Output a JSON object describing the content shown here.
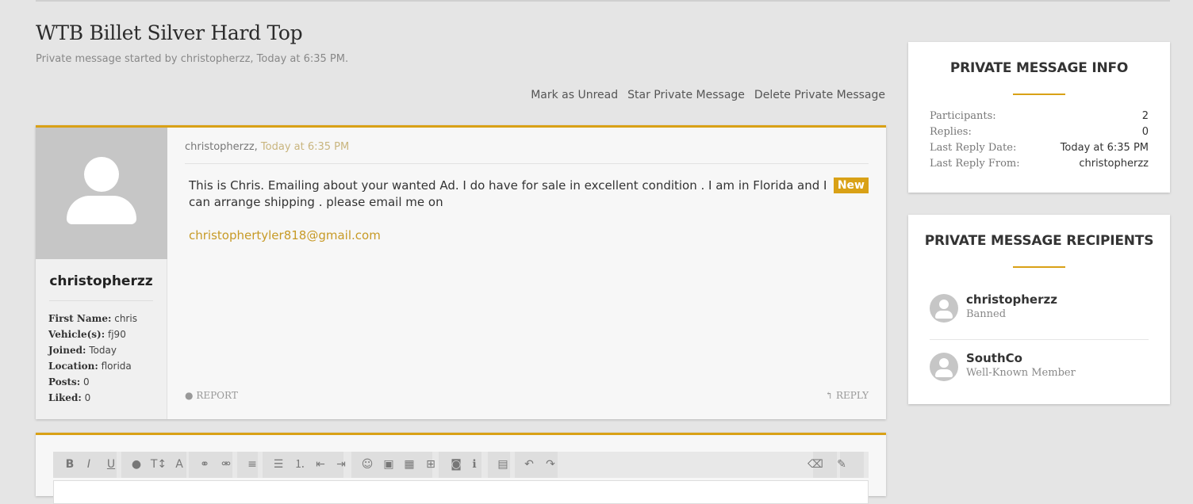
{
  "page": {
    "title": "WTB Billet Silver Hard Top",
    "subtitle": "Private message started by christopherzz, Today at 6:35 PM."
  },
  "actions": {
    "mark_unread": "Mark as Unread",
    "star": "Star Private Message",
    "delete": "Delete Private Message"
  },
  "message": {
    "author": "christopherzz",
    "meta_author": "christopherzz,",
    "meta_time": "Today at 6:35 PM",
    "badge": "New",
    "body": "This is Chris. Emailing about your wanted Ad. I do have for sale in excellent condition . I am in Florida and I can arrange shipping . please email me on",
    "email": "christophertyler818@gmail.com",
    "report": "REPORT",
    "reply": "REPLY",
    "user_info": [
      {
        "key": "First Name:",
        "value": "chris"
      },
      {
        "key": "Vehicle(s):",
        "value": "fj90"
      },
      {
        "key": "Joined:",
        "value": "Today"
      },
      {
        "key": "Location:",
        "value": "florida"
      },
      {
        "key": "Posts:",
        "value": "0"
      },
      {
        "key": "Liked:",
        "value": "0"
      }
    ]
  },
  "info_card": {
    "heading": "PRIVATE MESSAGE INFO",
    "rows": [
      {
        "key": "Participants:",
        "value": "2"
      },
      {
        "key": "Replies:",
        "value": "0"
      },
      {
        "key": "Last Reply Date:",
        "value": "Today at 6:35 PM"
      },
      {
        "key": "Last Reply From:",
        "value": "christopherzz"
      }
    ]
  },
  "recipients_card": {
    "heading": "PRIVATE MESSAGE RECIPIENTS",
    "recipients": [
      {
        "name": "christopherzz",
        "role": "Banned"
      },
      {
        "name": "SouthCo",
        "role": "Well-Known Member"
      }
    ]
  },
  "editor": {
    "toolbar": [
      {
        "icon": "bold-icon",
        "glyph": "B"
      },
      {
        "icon": "italic-icon",
        "glyph": "I"
      },
      {
        "icon": "underline-icon",
        "glyph": "U"
      },
      {
        "icon": "color-icon",
        "glyph": "●"
      },
      {
        "icon": "font-size-icon",
        "glyph": "T↕"
      },
      {
        "icon": "font-family-icon",
        "glyph": "A"
      },
      {
        "icon": "link-icon",
        "glyph": "⚭"
      },
      {
        "icon": "unlink-icon",
        "glyph": "⚮"
      },
      {
        "icon": "align-icon",
        "glyph": "≡"
      },
      {
        "icon": "bullet-list-icon",
        "glyph": "☰"
      },
      {
        "icon": "numbered-list-icon",
        "glyph": "⒈"
      },
      {
        "icon": "outdent-icon",
        "glyph": "⇤"
      },
      {
        "icon": "indent-icon",
        "glyph": "⇥"
      },
      {
        "icon": "smilie-icon",
        "glyph": "☺"
      },
      {
        "icon": "image-icon",
        "glyph": "▣"
      },
      {
        "icon": "media-icon",
        "glyph": "▦"
      },
      {
        "icon": "insert-icon",
        "glyph": "⊞"
      },
      {
        "icon": "camera-icon",
        "glyph": "◙"
      },
      {
        "icon": "info-icon",
        "glyph": "ℹ"
      },
      {
        "icon": "save-icon",
        "glyph": "▤"
      },
      {
        "icon": "undo-icon",
        "glyph": "↶"
      },
      {
        "icon": "redo-icon",
        "glyph": "↷"
      },
      {
        "icon": "eraser-icon",
        "glyph": "⌫"
      },
      {
        "icon": "wrench-icon",
        "glyph": "✎"
      }
    ]
  },
  "colors": {
    "accent": "#d9a116",
    "background": "#e5e5e5"
  }
}
